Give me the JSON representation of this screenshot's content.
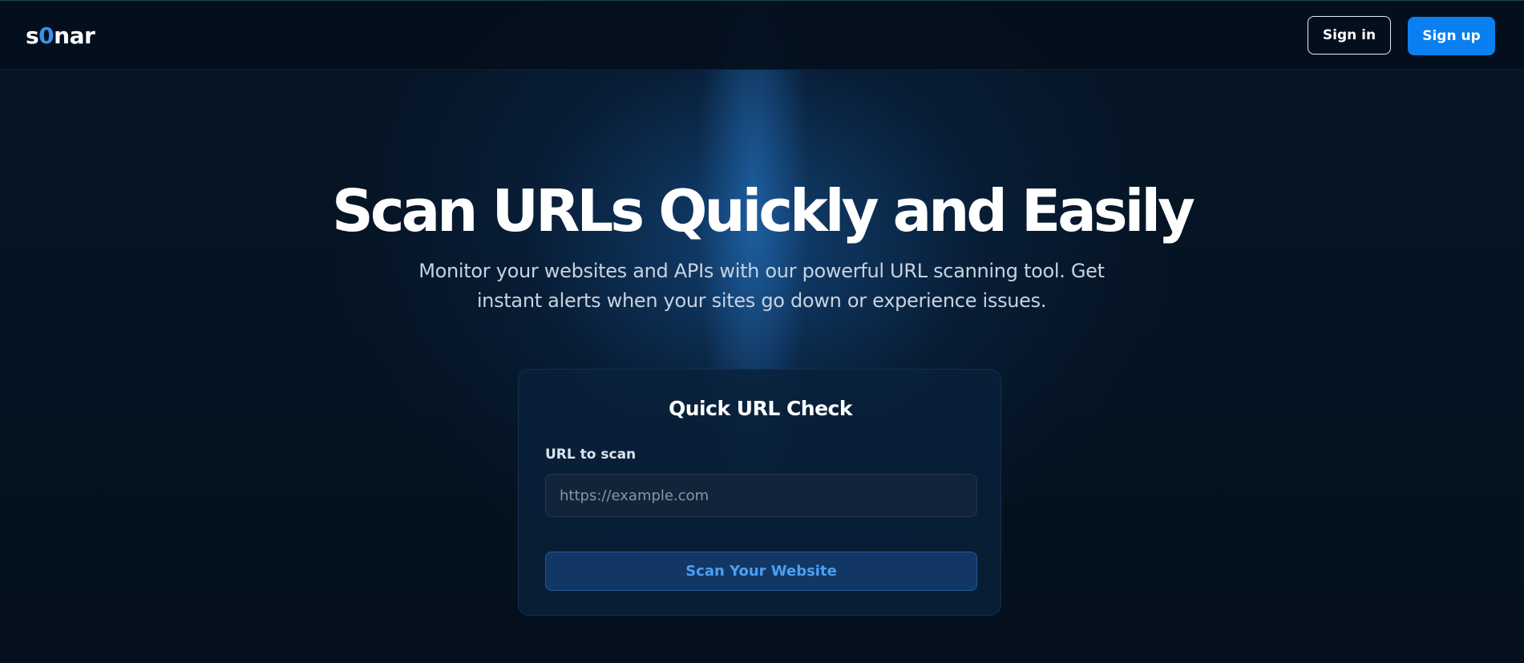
{
  "header": {
    "logo": {
      "prefix": "s",
      "accent": "0",
      "suffix": "nar"
    },
    "sign_in_label": "Sign in",
    "sign_up_label": "Sign up"
  },
  "hero": {
    "title": "Scan URLs Quickly and Easily",
    "subtitle": "Monitor your websites and APIs with our powerful URL scanning tool. Get instant alerts when your sites go down or experience issues."
  },
  "quick_check": {
    "title": "Quick URL Check",
    "field_label": "URL to scan",
    "input_value": "",
    "input_placeholder": "https://example.com",
    "button_label": "Scan Your Website"
  },
  "colors": {
    "brand_accent": "#3b8eea",
    "primary_button": "#0a7ff0",
    "background": "#05121f",
    "scan_button_text": "#4aa0f5"
  }
}
